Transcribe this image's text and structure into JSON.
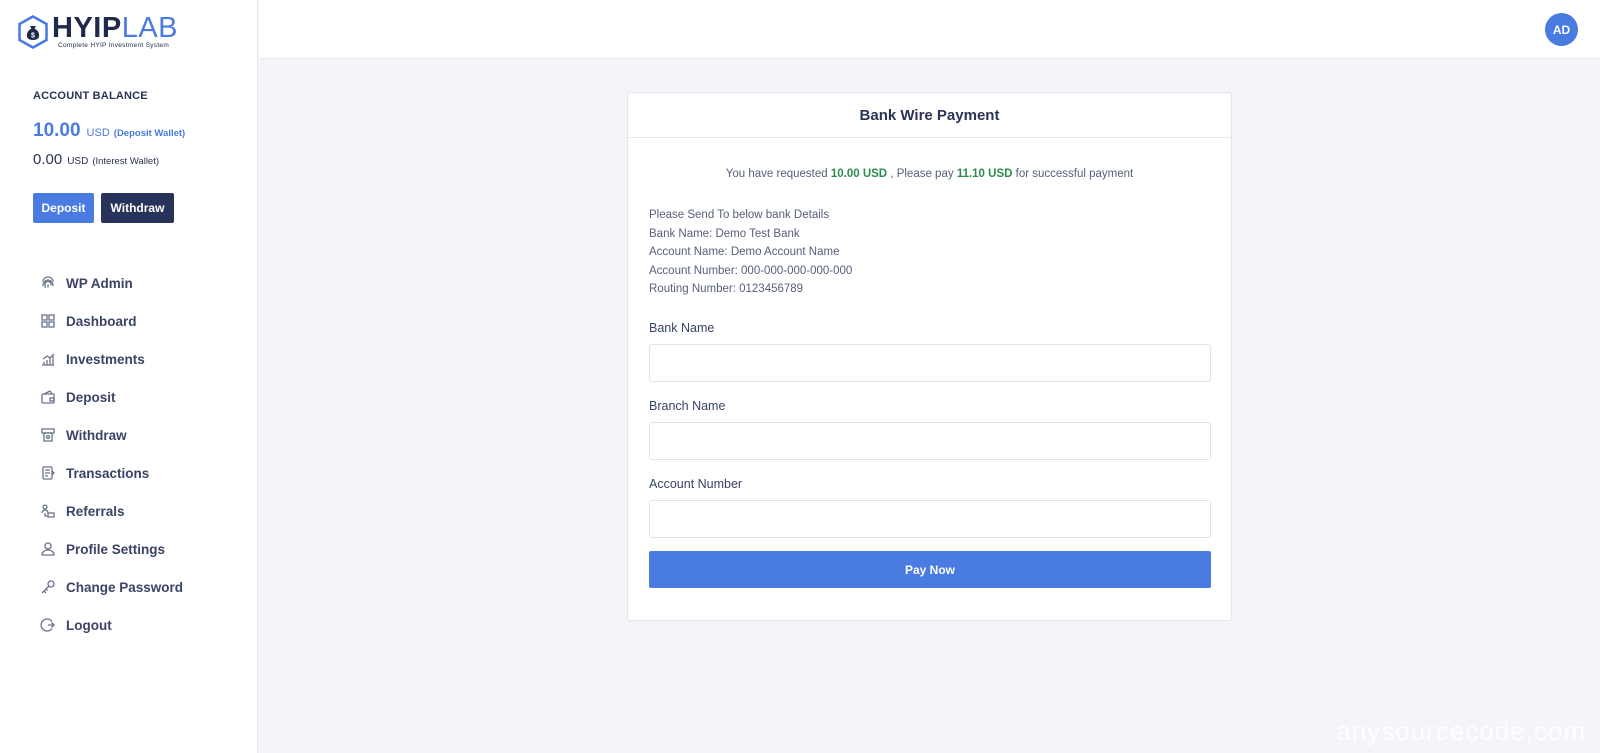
{
  "logo": {
    "word_part1": "HYIP",
    "word_part2": "LAB",
    "tagline": "Complete HYIP Investment System"
  },
  "balance": {
    "title": "ACCOUNT BALANCE",
    "deposit_amount": "10.00",
    "deposit_currency": "USD",
    "deposit_wallet": "(Deposit Wallet)",
    "interest_amount": "0.00",
    "interest_currency": "USD",
    "interest_wallet": "(Interest Wallet)",
    "deposit_button": "Deposit",
    "withdraw_button": "Withdraw"
  },
  "nav": [
    {
      "label": "WP Admin",
      "icon": "fingerprint-icon"
    },
    {
      "label": "Dashboard",
      "icon": "dashboard-icon"
    },
    {
      "label": "Investments",
      "icon": "investments-icon"
    },
    {
      "label": "Deposit",
      "icon": "wallet-icon"
    },
    {
      "label": "Withdraw",
      "icon": "atm-icon"
    },
    {
      "label": "Transactions",
      "icon": "transactions-icon"
    },
    {
      "label": "Referrals",
      "icon": "referrals-icon"
    },
    {
      "label": "Profile Settings",
      "icon": "user-icon"
    },
    {
      "label": "Change Password",
      "icon": "key-icon"
    },
    {
      "label": "Logout",
      "icon": "logout-icon"
    }
  ],
  "topbar": {
    "avatar_initials": "AD"
  },
  "card": {
    "title": "Bank Wire Payment",
    "req_prefix": "You have requested",
    "req_amount": "10.00 USD",
    "req_middle": ", Please pay",
    "pay_amount": "11.10 USD",
    "req_suffix": "for successful payment",
    "details": [
      "Please Send To below bank Details",
      "Bank Name: Demo Test Bank",
      "Account Name: Demo Account Name",
      "Account Number: 000-000-000-000-000",
      "Routing Number: 0123456789"
    ],
    "fields": [
      {
        "label": "Bank Name",
        "value": ""
      },
      {
        "label": "Branch Name",
        "value": ""
      },
      {
        "label": "Account Number",
        "value": ""
      }
    ],
    "pay_button": "Pay Now"
  },
  "watermark": "anysourcecode.com",
  "colors": {
    "accent": "#4a7be0",
    "dark": "#27335a",
    "success": "#2e8a4f"
  }
}
